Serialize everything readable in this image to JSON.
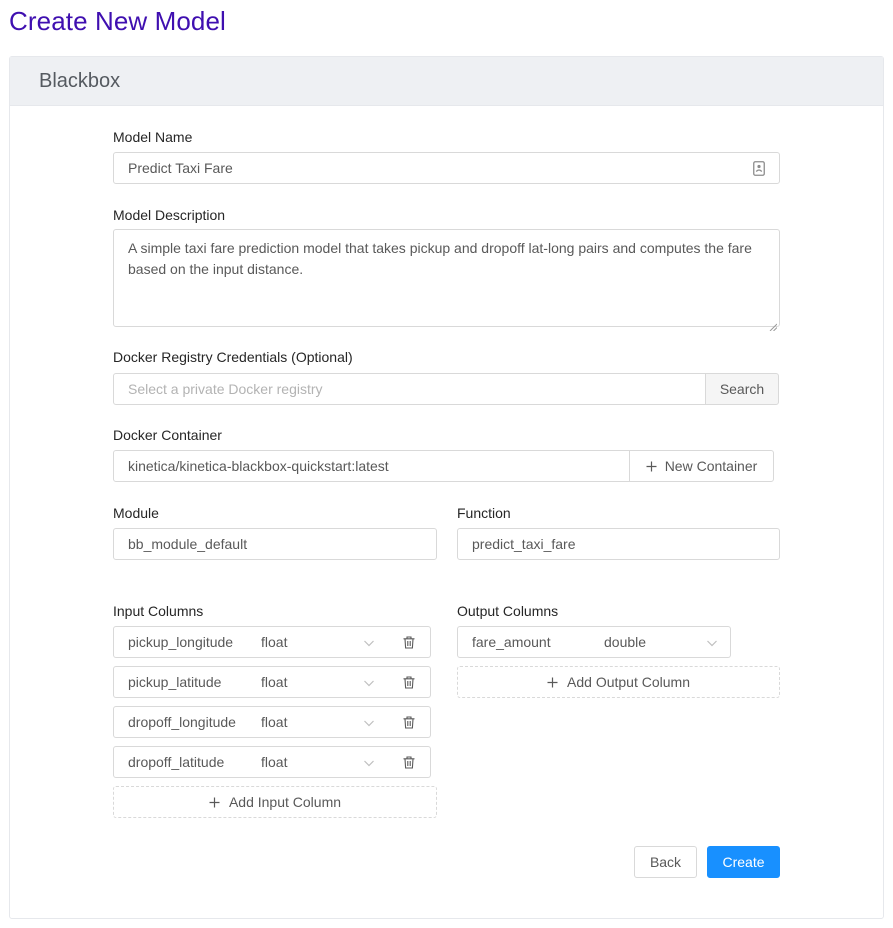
{
  "page": {
    "title": "Create New Model"
  },
  "card": {
    "title": "Blackbox"
  },
  "form": {
    "model_name": {
      "label": "Model Name",
      "value": "Predict Taxi Fare"
    },
    "model_description": {
      "label": "Model Description",
      "value": "A simple taxi fare prediction model that takes pickup and dropoff lat-long pairs and computes the fare based on the input distance."
    },
    "docker_registry": {
      "label": "Docker Registry Credentials (Optional)",
      "placeholder": "Select a private Docker registry",
      "button_label": "Search"
    },
    "docker_container": {
      "label": "Docker Container",
      "value": "kinetica/kinetica-blackbox-quickstart:latest",
      "button_label": "New Container"
    },
    "module": {
      "label": "Module",
      "value": "bb_module_default"
    },
    "function": {
      "label": "Function",
      "value": "predict_taxi_fare"
    },
    "input_columns": {
      "label": "Input Columns",
      "rows": [
        {
          "name": "pickup_longitude",
          "type": "float"
        },
        {
          "name": "pickup_latitude",
          "type": "float"
        },
        {
          "name": "dropoff_longitude",
          "type": "float"
        },
        {
          "name": "dropoff_latitude",
          "type": "float"
        }
      ],
      "add_label": "Add Input Column"
    },
    "output_columns": {
      "label": "Output Columns",
      "rows": [
        {
          "name": "fare_amount",
          "type": "double"
        }
      ],
      "add_label": "Add Output Column"
    }
  },
  "actions": {
    "back_label": "Back",
    "create_label": "Create"
  },
  "colors": {
    "title": "#3f0fb0",
    "primary": "#1890ff",
    "header_bg": "#eef0f3",
    "border": "#d9d9d9"
  },
  "icons": {
    "name_field": "contact-card-icon",
    "delete": "trash-icon",
    "select": "chevron-down-icon",
    "add": "plus-icon"
  }
}
